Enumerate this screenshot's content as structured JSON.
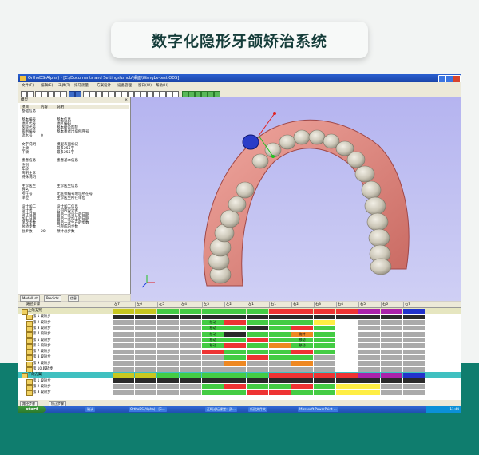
{
  "banner": {
    "title": "数字化隐形牙颌矫治系统"
  },
  "window": {
    "title": "OrthoDS(Alpha) - [C:\\Documents and Settings\\zmob\\桌面\\WangLx-test.ODS]",
    "menu": [
      "文件(F)",
      "编辑(E)",
      "工具(T)",
      "排牙测量",
      "方案设计",
      "设备管理",
      "窗口(W)",
      "帮助(H)"
    ]
  },
  "left_panel": {
    "title": "模型",
    "headers": [
      "项目",
      "内容",
      "说明"
    ],
    "rows": [
      [
        "基础信息",
        "",
        ""
      ],
      [
        "",
        "",
        ""
      ],
      [
        "基本编号",
        "",
        "基本信息"
      ],
      [
        "地区代号",
        "",
        "地区编码"
      ],
      [
        "医院代号",
        "",
        "基本接诊医院"
      ],
      [
        "病例编号",
        "",
        "基本患者出病例序号"
      ],
      [
        "流水号",
        "0",
        ""
      ],
      [
        "",
        "",
        ""
      ],
      [
        "文字说明",
        "",
        "模型表面标记"
      ],
      [
        "上颌",
        "",
        "最多255字"
      ],
      [
        "下颌",
        "",
        "最多255字"
      ],
      [
        "",
        "",
        ""
      ],
      [
        "患者信息",
        "",
        "患者基本信息"
      ],
      [
        "性别",
        "",
        ""
      ],
      [
        "年龄",
        "",
        ""
      ],
      [
        "简明主诉",
        "",
        ""
      ],
      [
        "特殊说明",
        "",
        ""
      ],
      [
        "",
        "",
        ""
      ],
      [
        "主诊医生",
        "",
        "主诊医生信息"
      ],
      [
        "姓名",
        "",
        ""
      ],
      [
        "所在号",
        "",
        "无医师编号地址所在号"
      ],
      [
        "单位",
        "",
        "主诊医生所在单位"
      ],
      [
        "",
        "",
        ""
      ],
      [
        "设计加工",
        "",
        "设计加工信息"
      ],
      [
        "设计者",
        "",
        "公司内设计者"
      ],
      [
        "设计日期",
        "",
        "最后一次设计的日期"
      ],
      [
        "加工日期",
        "",
        "最后一次加工的日期"
      ],
      [
        "单次步数",
        "",
        "最后一次生产的步数"
      ],
      [
        "总矫步数",
        "",
        "已完成的步数"
      ],
      [
        "总步数",
        "20",
        "预计总步数"
      ]
    ],
    "tabs": [
      "ModelList",
      "Predicts",
      "信息"
    ]
  },
  "gantt": {
    "header_label": "路径步骤",
    "columns": [
      "左7",
      "左6",
      "左5",
      "左4",
      "左3",
      "左2",
      "左1",
      "右1",
      "右2",
      "右3",
      "右4",
      "右5",
      "右6",
      "右7"
    ],
    "rows": [
      {
        "label": "上颌方案",
        "level": 0,
        "cells": []
      },
      {
        "label": "第 1 段矫步",
        "level": 1,
        "cells": []
      },
      {
        "label": "第 2 段矫步",
        "level": 1,
        "cells": [
          "",
          "",
          "",
          "",
          "移动",
          "",
          "",
          "",
          "",
          "",
          "",
          "",
          "",
          ""
        ]
      },
      {
        "label": "第 3 段矫步",
        "level": 1,
        "cells": [
          "",
          "",
          "",
          "",
          "移动",
          "",
          "",
          "",
          "",
          "",
          "",
          "",
          "",
          ""
        ]
      },
      {
        "label": "第 4 段矫步",
        "level": 1,
        "cells": [
          "",
          "",
          "",
          "",
          "移动",
          "",
          "",
          "",
          "旋转",
          "",
          "",
          "",
          "",
          ""
        ]
      },
      {
        "label": "第 5 段矫步",
        "level": 1,
        "cells": [
          "",
          "",
          "",
          "",
          "移动",
          "",
          "",
          "",
          "移动",
          "",
          "",
          "",
          "",
          ""
        ]
      },
      {
        "label": "第 6 段矫步",
        "level": 1,
        "cells": [
          "",
          "",
          "",
          "",
          "移动",
          "",
          "",
          "",
          "移动",
          "",
          "",
          "",
          "",
          ""
        ]
      },
      {
        "label": "第 7 段矫步",
        "level": 1,
        "cells": [
          "",
          "",
          "",
          "",
          "",
          "",
          "",
          "",
          "",
          "",
          "",
          "",
          "",
          ""
        ]
      },
      {
        "label": "第 8 段矫步",
        "level": 1,
        "cells": [
          "",
          "",
          "",
          "",
          "",
          "",
          "",
          "",
          "",
          "",
          "",
          "",
          "",
          ""
        ]
      },
      {
        "label": "第 9 段矫步",
        "level": 1,
        "cells": [
          "",
          "",
          "",
          "",
          "",
          "",
          "",
          "",
          "",
          "",
          "",
          "",
          "",
          ""
        ]
      },
      {
        "label": "第 10 段矫步",
        "level": 1,
        "cells": [
          "",
          "",
          "",
          "",
          "",
          "",
          "",
          "",
          "",
          "",
          "",
          "",
          "",
          ""
        ]
      },
      {
        "label": "下颌方案",
        "level": 0,
        "cells": []
      },
      {
        "label": "第 1 段矫步",
        "level": 1,
        "cells": []
      },
      {
        "label": "第 2 段矫步",
        "level": 1,
        "cells": [
          "",
          "",
          "",
          "",
          "",
          "",
          "",
          "",
          "",
          "",
          "",
          "",
          "",
          ""
        ]
      },
      {
        "label": "第 3 段矫步",
        "level": 1,
        "cells": [
          "",
          "",
          "",
          "",
          "",
          "",
          "",
          "",
          "",
          "",
          "",
          "",
          "",
          ""
        ]
      }
    ]
  },
  "bottom_tabs": [
    "路径步骤",
    "矫正步骤"
  ],
  "taskbar": {
    "start": "start",
    "items": [
      "确认",
      "OrthoDS(Alpha) - [C...",
      "正畸论坛课堂：武...",
      "新建文件夹",
      "Microsoft PowerPoint ..."
    ],
    "clock": "11:44"
  }
}
